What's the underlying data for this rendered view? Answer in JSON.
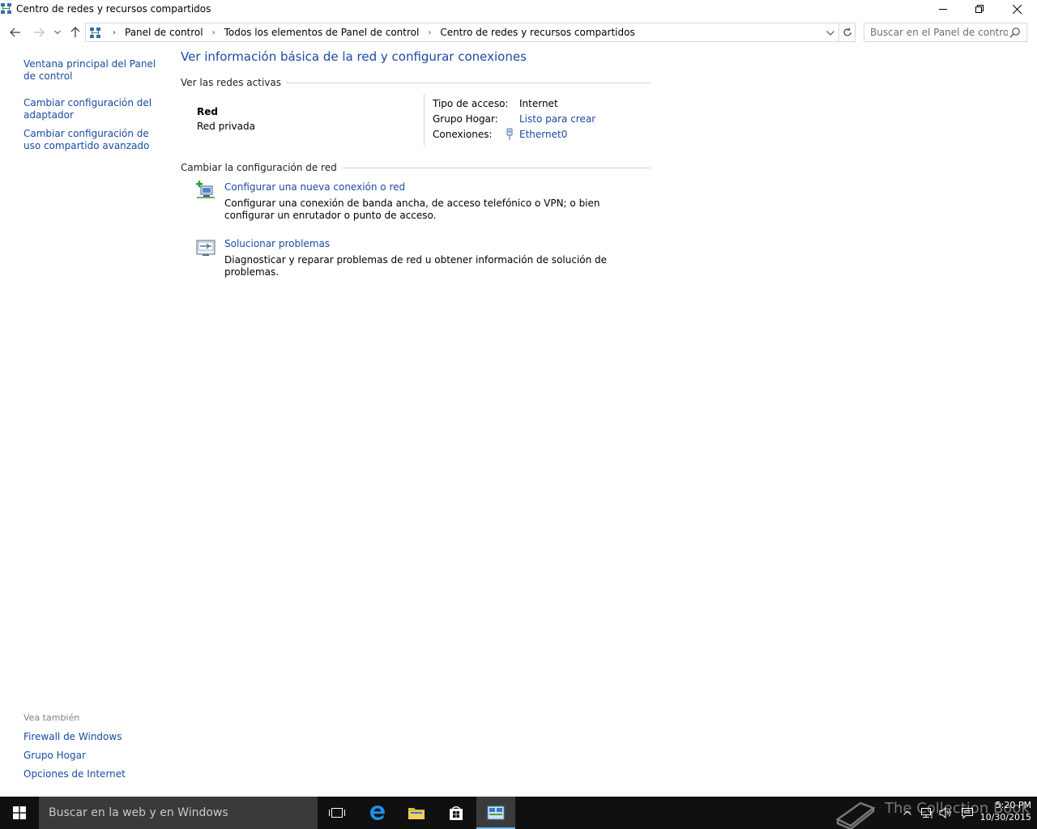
{
  "window": {
    "title": "Centro de redes y recursos compartidos"
  },
  "address_bar": {
    "crumbs": [
      "Panel de control",
      "Todos los elementos de Panel de control",
      "Centro de redes y recursos compartidos"
    ]
  },
  "search": {
    "placeholder": "Buscar en el Panel de control"
  },
  "left_pane": {
    "links": [
      "Ventana principal del Panel de control",
      "Cambiar configuración del adaptador",
      "Cambiar configuración de uso compartido avanzado"
    ],
    "see_also_label": "Vea también",
    "see_also_links": [
      "Firewall de Windows",
      "Grupo Hogar",
      "Opciones de Internet"
    ]
  },
  "main": {
    "title": "Ver información básica de la red y configurar conexiones",
    "active_networks_header": "Ver las redes activas",
    "network": {
      "name": "Red",
      "type": "Red privada",
      "access_type_label": "Tipo de acceso:",
      "access_type_value": "Internet",
      "homegroup_label": "Grupo Hogar:",
      "homegroup_value": "Listo para crear",
      "connections_label": "Conexiones:",
      "connections_value": "Ethernet0"
    },
    "change_settings_header": "Cambiar la configuración de red",
    "tasks": [
      {
        "link": "Configurar una nueva conexión o red",
        "description": "Configurar una conexión de banda ancha, de acceso telefónico o VPN; o bien configurar un enrutador o punto de acceso.",
        "icon": "new-connection-icon"
      },
      {
        "link": "Solucionar problemas",
        "description": "Diagnosticar y reparar problemas de red u obtener información de solución de problemas.",
        "icon": "troubleshoot-icon"
      }
    ]
  },
  "taskbar": {
    "search_text": "Buscar en la web y en Windows",
    "watermark": "The Collection Book",
    "clock_time": "5:20 PM",
    "clock_date": "10/30/2015"
  },
  "colors": {
    "link": "#1a4aa3",
    "taskbar": "#101010",
    "active_app_underline": "#76b9ed"
  }
}
